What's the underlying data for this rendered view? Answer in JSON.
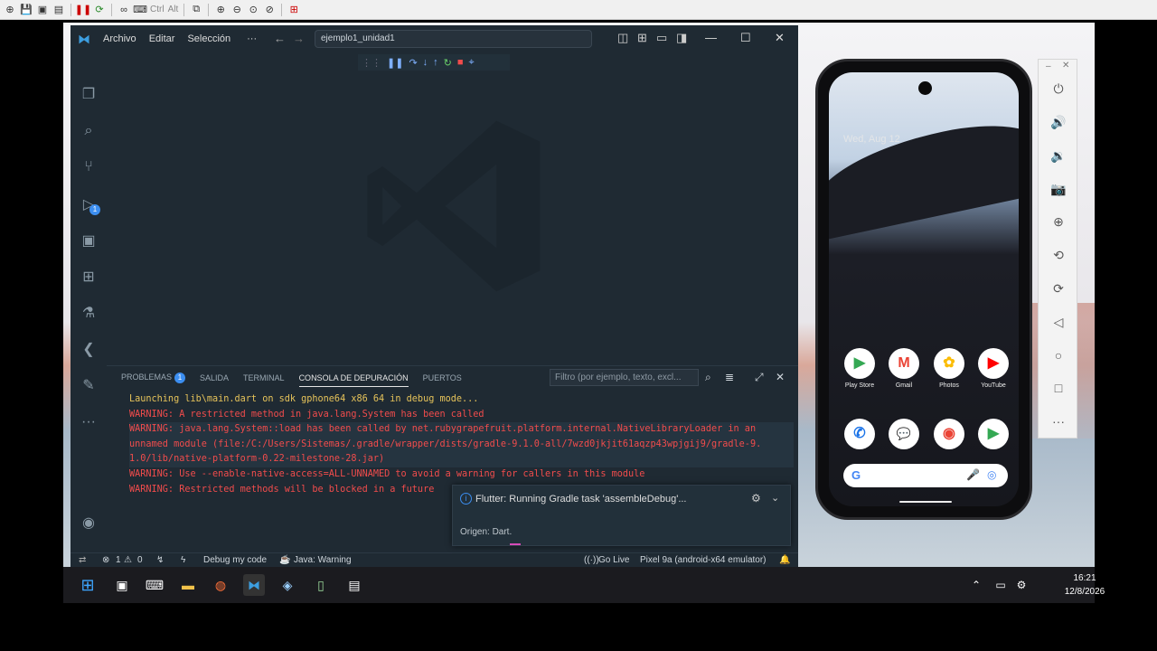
{
  "host_toolbar": {
    "ctrl_label": "Ctrl",
    "alt_label": "Alt"
  },
  "vscode": {
    "menu": [
      "Archivo",
      "Editar",
      "Selección",
      "···"
    ],
    "command_center": "ejemplo1_unidad1",
    "panel": {
      "tabs": [
        {
          "label": "PROBLEMAS",
          "badge": "1"
        },
        {
          "label": "SALIDA"
        },
        {
          "label": "TERMINAL"
        },
        {
          "label": "CONSOLA DE DEPURACIÓN",
          "active": true
        },
        {
          "label": "PUERTOS"
        }
      ],
      "filter_placeholder": "Filtro (por ejemplo, texto, excl...",
      "console_lines": [
        {
          "text": "Launching lib\\main.dart on sdk gphone64 x86 64 in debug mode...",
          "kind": "info"
        },
        {
          "text": "WARNING: A restricted method in java.lang.System has been called",
          "kind": "warning"
        },
        {
          "text": "WARNING: java.lang.System::load has been called by net.rubygrapefruit.platform.internal.NativeLibraryLoader in an",
          "kind": "warning",
          "selected": true
        },
        {
          "text": "unnamed module (file:/C:/Users/Sistemas/.gradle/wrapper/dists/gradle-9.1.0-all/7wzd0jkjit61aqzp43wpjgij9/gradle-9.",
          "kind": "warning",
          "selected": true
        },
        {
          "text": "1.0/lib/native-platform-0.22-milestone-28.jar)",
          "kind": "warning",
          "selected": true
        },
        {
          "text": "WARNING: Use --enable-native-access=ALL-UNNAMED to avoid a warning for callers in this module",
          "kind": "warning"
        },
        {
          "text": "WARNING: Restricted methods will be blocked in a future",
          "kind": "warning"
        }
      ]
    },
    "notification": {
      "message": "Flutter: Running Gradle task 'assembleDebug'...",
      "origin": "Origen: Dart."
    },
    "statusbar": {
      "errors": "1",
      "warnings": "0",
      "debug_label": "Debug my code",
      "java_label": "Java: Warning",
      "go_live": "Go Live",
      "device": "Pixel 9a (android-x64 emulator)"
    }
  },
  "phone": {
    "date": "Wed, Aug 12",
    "apps_row1": [
      {
        "label": "Play Store",
        "icon": "play-store-icon",
        "glyph": "▶",
        "color": "#34a853"
      },
      {
        "label": "Gmail",
        "icon": "gmail-icon",
        "glyph": "M",
        "color": "#ea4335"
      },
      {
        "label": "Photos",
        "icon": "photos-icon",
        "glyph": "✿",
        "color": "#fbbc05"
      },
      {
        "label": "YouTube",
        "icon": "youtube-icon",
        "glyph": "▶",
        "color": "#ff0000"
      }
    ],
    "apps_row2": [
      {
        "icon": "phone-icon",
        "glyph": "✆",
        "color": "#1a73e8"
      },
      {
        "icon": "messages-icon",
        "glyph": "💬",
        "color": "#1a73e8"
      },
      {
        "icon": "chrome-icon",
        "glyph": "◉",
        "color": "#ea4335"
      },
      {
        "icon": "play-games-icon",
        "glyph": "▶",
        "color": "#34a853"
      }
    ]
  },
  "taskbar": {
    "time": "16:21",
    "date": "12/8/2026"
  }
}
